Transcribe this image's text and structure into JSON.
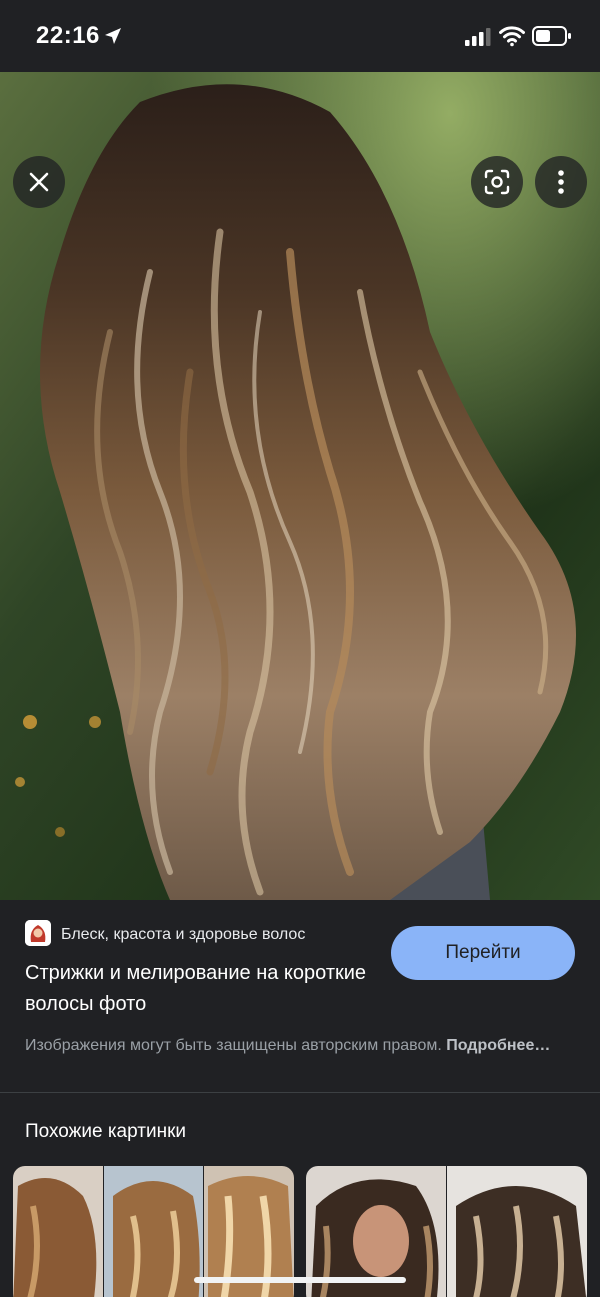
{
  "status_bar": {
    "time": "22:16",
    "icons": [
      "location-arrow-icon",
      "cellular-signal-icon",
      "wifi-icon",
      "battery-icon"
    ]
  },
  "viewer": {
    "buttons": [
      "close-icon",
      "google-lens-icon",
      "more-vert-icon"
    ]
  },
  "result": {
    "source_name": "Блеск, красота и здоровье волос",
    "title": "Стрижки и мелирование на короткие волосы фото",
    "visit_label": "Перейти",
    "copyright_text": "Изображения могут быть защищены авторским правом.",
    "more_label": "Подробнее…"
  },
  "similar": {
    "heading": "Похожие картинки"
  },
  "colors": {
    "background": "#202124",
    "accent_button": "#8ab4f8",
    "secondary_text": "#9aa0a6"
  }
}
